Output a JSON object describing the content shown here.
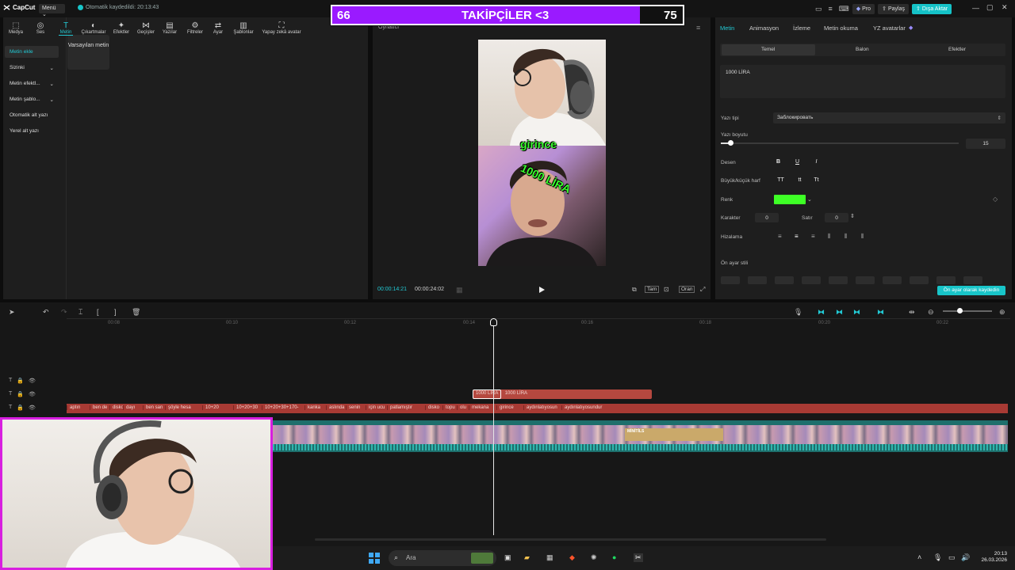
{
  "app": {
    "logo_text": "CapCut",
    "menu_label": "Menü",
    "autosave_text": "Otomatik kaydedildi: 20:13:43",
    "pro_label": "Pro",
    "share_label": "Paylaş",
    "export_label": "Dışa Aktar"
  },
  "follower_overlay": {
    "current": "66",
    "title": "TAKİPÇİLER <3",
    "goal": "75",
    "progress_fraction": 0.88
  },
  "toolbar": {
    "items": [
      "Medya",
      "Ses",
      "Metin",
      "Çıkartmalar",
      "Efektler",
      "Geçişler",
      "Yazılar",
      "Filtreler",
      "Ayar",
      "Şablonlar",
      "Yapay zekâ avatar"
    ],
    "active_index": 2
  },
  "left_sidebar": {
    "items": [
      "Metin ekle",
      "Sizinki",
      "Metin efektl...",
      "Metin şablo...",
      "Otomatik alt yazı",
      "Yerel alt yazı"
    ],
    "active_index": 0,
    "default_card": "Varsayılan metin"
  },
  "player": {
    "title": "Oynatıcı",
    "current_time": "00:00:14:21",
    "total_time": "00:00:24:02",
    "caption_top": "girince",
    "caption_bottom": "1000 LİRA",
    "btn_full": "Tam",
    "btn_ratio": "Oran"
  },
  "inspector": {
    "tabs": [
      "Metin",
      "Animasyon",
      "İzleme",
      "Metin okuma",
      "YZ avatarlar"
    ],
    "active_tab": 0,
    "subtabs": [
      "Temel",
      "Balon",
      "Efektler"
    ],
    "text_value": "1000 LİRA",
    "font_label": "Yazı tipi",
    "font_value": "Заблокировать",
    "size_label": "Yazı boyutu",
    "size_value": "15",
    "pattern_label": "Desen",
    "pattern_buttons": [
      "B",
      "U",
      "I"
    ],
    "case_label": "Büyük/küçük harf",
    "case_buttons": [
      "TT",
      "tt",
      "Tt"
    ],
    "color_label": "Renk",
    "text_color": "#3eff26",
    "char_label": "Karakter",
    "char_value": "0",
    "line_label": "Satır",
    "line_value": "0",
    "align_label": "Hizalama",
    "preset_label": "Ön ayar stili",
    "saved_badge": "Ön ayar olarak kaydedin"
  },
  "timeline": {
    "ruler": [
      "00:08",
      "00:10",
      "00:12",
      "00:14",
      "00:16",
      "00:18",
      "00:20",
      "00:22"
    ],
    "text_clip_a": "1000 LİRA",
    "text_clip_b": "1000 LİRA",
    "subtitle_clips": [
      "aptın",
      "ben de",
      "disko",
      "dayı",
      "ben san",
      "şöyle hesa",
      "10+20",
      "10+20+30",
      "10+20+30+170-",
      "kanka",
      "aslında",
      "senin",
      "için ucu",
      "patlamıştır",
      "disko",
      "topu",
      "olu",
      "mekana",
      "girince",
      "aydınlatıyosun",
      "aydınlatıyosundur"
    ],
    "mini_clip_label": "MİNİTİLS"
  },
  "taskbar": {
    "search_placeholder": "Ara",
    "time": "20:13",
    "date": "26.03.2026"
  },
  "colors": {
    "accent": "#22c9d4",
    "overlay_purple": "#9a1aff",
    "webcam_border": "#d81fe0",
    "subtitle_track": "#a83a34"
  }
}
